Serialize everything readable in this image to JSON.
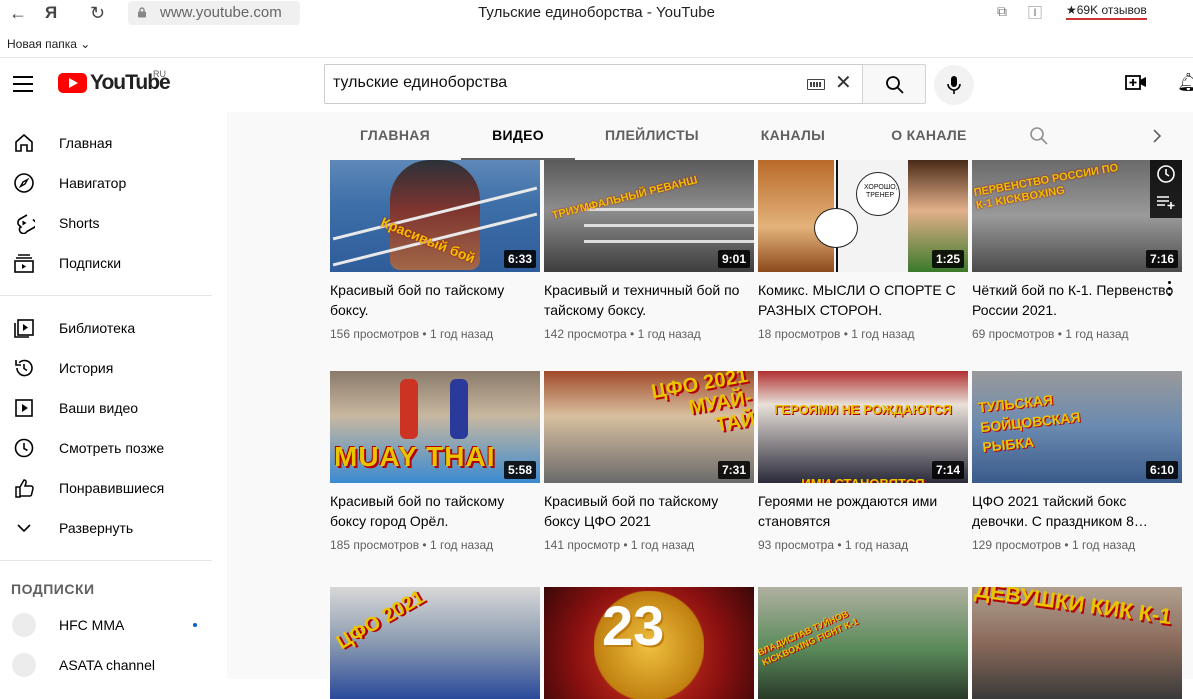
{
  "browser": {
    "url": "www.youtube.com",
    "title": "Тульские единоборства - YouTube",
    "reviews": "★69K отзывов",
    "bookmark_folder": "Новая папка"
  },
  "masthead": {
    "logo_text": "YouTube",
    "region": "RU",
    "search_value": "тульские единоборства",
    "clear_symbol": "✕"
  },
  "sidebar": {
    "main": [
      {
        "label": "Главная",
        "icon": "home-icon"
      },
      {
        "label": "Навигатор",
        "icon": "compass-icon"
      },
      {
        "label": "Shorts",
        "icon": "shorts-icon"
      },
      {
        "label": "Подписки",
        "icon": "subscriptions-icon"
      }
    ],
    "library": [
      {
        "label": "Библиотека",
        "icon": "library-icon"
      },
      {
        "label": "История",
        "icon": "history-icon"
      },
      {
        "label": "Ваши видео",
        "icon": "your-videos-icon"
      },
      {
        "label": "Смотреть позже",
        "icon": "watch-later-icon"
      },
      {
        "label": "Понравившиеся",
        "icon": "thumb-up-icon"
      },
      {
        "label": "Развернуть",
        "icon": "chevron-down-icon"
      }
    ],
    "subs_heading": "ПОДПИСКИ",
    "subscriptions": [
      {
        "label": "HFC MMA"
      },
      {
        "label": "ASATA channel"
      }
    ]
  },
  "tabs": [
    "ГЛАВНАЯ",
    "ВИДЕО",
    "ПЛЕЙЛИСТЫ",
    "КАНАЛЫ",
    "О КАНАЛЕ"
  ],
  "videos": [
    {
      "title": "Красивый бой по тайскому боксу.",
      "views": "156 просмотров",
      "age": "1 год назад",
      "duration": "6:33",
      "overlay": "Красивый бой"
    },
    {
      "title": "Красивый и техничный бой по тайскому боксу.",
      "views": "142 просмотра",
      "age": "1 год назад",
      "duration": "9:01",
      "overlay": "ТРИУМФАЛЬНЫЙ РЕВАНШ"
    },
    {
      "title": "Комикс. МЫСЛИ О СПОРТЕ С РАЗНЫХ СТОРОН.",
      "views": "18 просмотров",
      "age": "1 год назад",
      "duration": "1:25",
      "overlay": "ХОРОШО, ТРЕНЕР"
    },
    {
      "title": "Чёткий бой по К-1. Первенство России 2021.",
      "views": "69 просмотров",
      "age": "1 год назад",
      "duration": "7:16",
      "overlay": "ПЕРВЕНСТВО РОССИИ ПО К-1 KICKBOXING"
    },
    {
      "title": "Красивый бой по тайскому боксу город Орёл.",
      "views": "185 просмотров",
      "age": "1 год назад",
      "duration": "5:58",
      "overlay": "MUAY THAI"
    },
    {
      "title": "Красивый бой по тайскому боксу ЦФО 2021",
      "views": "141 просмотр",
      "age": "1 год назад",
      "duration": "7:31",
      "overlay": "ЦФО 2021 МУАЙ-ТАЙ"
    },
    {
      "title": "Героями не рождаются ими становятся",
      "views": "93 просмотра",
      "age": "1 год назад",
      "duration": "7:14",
      "overlay": "ГЕРОЯМИ НЕ РОЖДАЮТСЯ ИМИ СТАНОВЯТСЯ"
    },
    {
      "title": "ЦФО 2021 тайский бокс девочки. С праздником 8…",
      "views": "129 просмотров",
      "age": "1 год назад",
      "duration": "6:10",
      "overlay": "ТУЛЬСКАЯ БОЙЦОВСКАЯ РЫБКА"
    },
    {
      "title": "",
      "views": "",
      "age": "",
      "duration": "",
      "overlay": "ЦФО 2021"
    },
    {
      "title": "",
      "views": "",
      "age": "",
      "duration": "",
      "overlay": "23"
    },
    {
      "title": "",
      "views": "",
      "age": "",
      "duration": "",
      "overlay": "ВЛАДИСЛАВ ТУЙНОВ KICKBOXING FIGHT K-1"
    },
    {
      "title": "",
      "views": "",
      "age": "",
      "duration": "",
      "overlay": "ДЕВУШКИ КИК К-1"
    }
  ],
  "colors": {
    "accent": "#ff0000",
    "overlay_text": "#e9c400",
    "overlay_stroke": "#b30000"
  }
}
